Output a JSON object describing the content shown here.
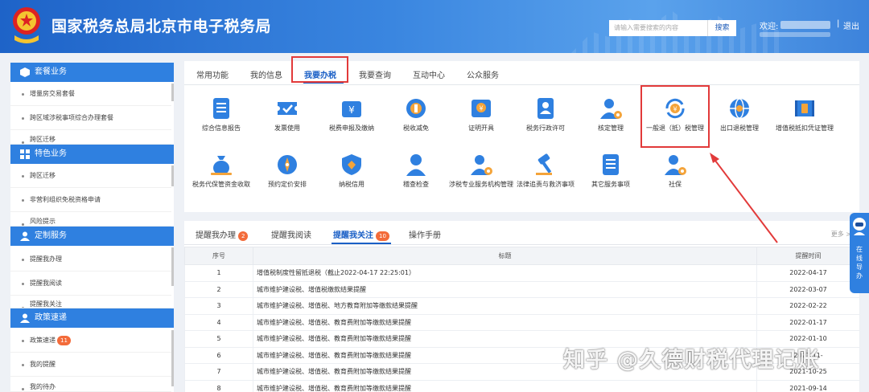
{
  "header": {
    "title": "国家税务总局北京市电子税务局",
    "search_placeholder": "请输入需要搜索的内容",
    "search_button": "搜索",
    "welcome": "欢迎",
    "logout": "退出",
    "brand_color": "#2f80e0"
  },
  "sidebar": {
    "sections": [
      {
        "title": "套餐业务",
        "icon": "cube-icon",
        "items": [
          "增量房交易套餐",
          "跨区域涉税事项综合办理套餐",
          "跨区迁移"
        ]
      },
      {
        "title": "特色业务",
        "icon": "grid-icon",
        "items": [
          "跨区迁移",
          "非营利组织免税资格申请",
          "风险提示"
        ]
      },
      {
        "title": "定制服务",
        "icon": "user-icon",
        "items": [
          "提醒我办理",
          "提醒我阅读",
          "提醒我关注"
        ]
      },
      {
        "title": "政策速递",
        "icon": "user-icon",
        "items": [
          "政策速递",
          "我的提醒",
          "我的待办"
        ],
        "badge": "11"
      }
    ]
  },
  "top_tabs": [
    "常用功能",
    "我的信息",
    "我要办税",
    "我要查询",
    "互动中心",
    "公众服务"
  ],
  "active_top_tab": "我要办税",
  "functions": [
    {
      "label": "综合信息报告",
      "icon": "document-list-icon"
    },
    {
      "label": "发票使用",
      "icon": "ticket-check-icon"
    },
    {
      "label": "税费申报及缴纳",
      "icon": "wallet-yen-icon"
    },
    {
      "label": "税收减免",
      "icon": "coin-stack-icon"
    },
    {
      "label": "证明开具",
      "icon": "certificate-yen-icon"
    },
    {
      "label": "税务行政许可",
      "icon": "id-card-icon"
    },
    {
      "label": "核定管理",
      "icon": "user-gear-icon"
    },
    {
      "label": "一般退（抵）税管理",
      "icon": "yen-refresh-icon"
    },
    {
      "label": "出口退税管理",
      "icon": "globe-icon"
    },
    {
      "label": "增值税抵扣凭证管理",
      "icon": "invoice-stamp-icon"
    },
    {
      "label": "税务代保管资金收取",
      "icon": "money-bag-icon"
    },
    {
      "label": "预约定价安排",
      "icon": "compass-icon"
    },
    {
      "label": "纳税信用",
      "icon": "shield-diamond-icon"
    },
    {
      "label": "稽查检查",
      "icon": "user-icon"
    },
    {
      "label": "涉税专业服务机构管理",
      "icon": "user-gear-icon"
    },
    {
      "label": "法律追责与救济事项",
      "icon": "gavel-icon"
    },
    {
      "label": "其它服务事项",
      "icon": "document-list-icon"
    },
    {
      "label": "社保",
      "icon": "user-gear-icon"
    }
  ],
  "notice_tabs": [
    {
      "label": "提醒我办理",
      "badge": "2"
    },
    {
      "label": "提醒我阅读",
      "badge": ""
    },
    {
      "label": "提醒我关注",
      "badge": "10"
    },
    {
      "label": "操作手册",
      "badge": ""
    }
  ],
  "more_label": "更多",
  "table": {
    "headers": [
      "序号",
      "标题",
      "提醒时间"
    ],
    "rows": [
      {
        "no": "1",
        "title": "增值税制度性留抵退税（截止2022-04-17 22:25:01）",
        "date": "2022-04-17"
      },
      {
        "no": "2",
        "title": "城市维护建设税、增值税缴款结果提醒",
        "date": "2022-03-07"
      },
      {
        "no": "3",
        "title": "城市维护建设税、增值税、地方教育附加等缴款结果提醒",
        "date": "2022-02-22"
      },
      {
        "no": "4",
        "title": "城市维护建设税、增值税、教育费附加等缴款结果提醒",
        "date": "2022-01-17"
      },
      {
        "no": "5",
        "title": "城市维护建设税、增值税、教育费附加等缴款结果提醒",
        "date": "2022-01-10"
      },
      {
        "no": "6",
        "title": "城市维护建设税、增值税、教育费附加等缴款结果提醒",
        "date": "2021-11-"
      },
      {
        "no": "7",
        "title": "城市维护建设税、增值税、教育费附加等缴款结果提醒",
        "date": "2021-10-25"
      },
      {
        "no": "8",
        "title": "城市维护建设税、增值税、教育费附加等缴款结果提醒",
        "date": "2021-09-14"
      }
    ]
  },
  "online_guide": "在线导办",
  "watermark": "知乎 @久德财税代理记账",
  "highlight_color": "#e23a3a"
}
